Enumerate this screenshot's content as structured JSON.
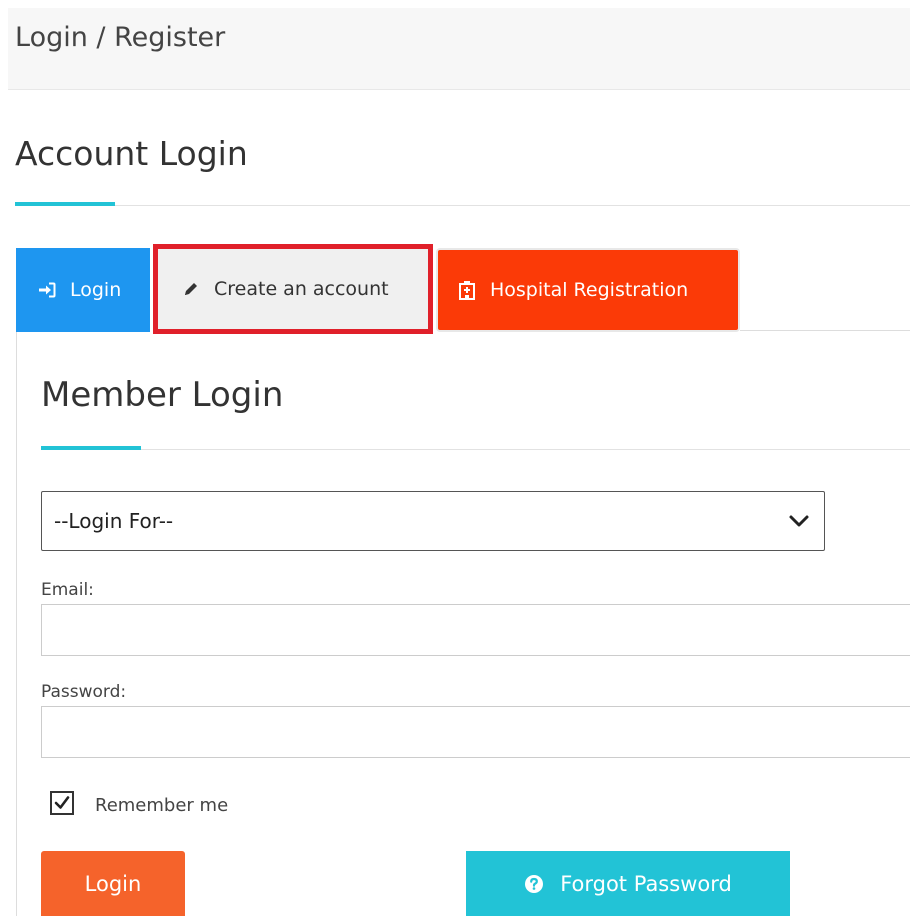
{
  "header": {
    "title": "Login / Register"
  },
  "section": {
    "title": "Account Login"
  },
  "tabs": [
    {
      "label": "Login",
      "icon": "sign-in-icon",
      "color": "#1e96f0",
      "active": true
    },
    {
      "label": "Create an account",
      "icon": "pencil-icon",
      "color": "#f0f0f0",
      "highlighted": true
    },
    {
      "label": "Hospital Registration",
      "icon": "hospital-icon",
      "color": "#fb3a07"
    }
  ],
  "form": {
    "title": "Member Login",
    "login_for": {
      "selected": "--Login For--",
      "icon": "chevron-down-icon"
    },
    "email": {
      "label": "Email:",
      "value": "",
      "placeholder": ""
    },
    "password": {
      "label": "Password:",
      "value": "",
      "placeholder": ""
    },
    "remember": {
      "label": "Remember me",
      "checked": true
    },
    "login_button": "Login",
    "forgot_button": "Forgot Password"
  },
  "colors": {
    "accent": "#22c3d6",
    "login_button": "#f5632b",
    "forgot_button": "#22c3d6",
    "highlight_border": "#e0202a"
  }
}
